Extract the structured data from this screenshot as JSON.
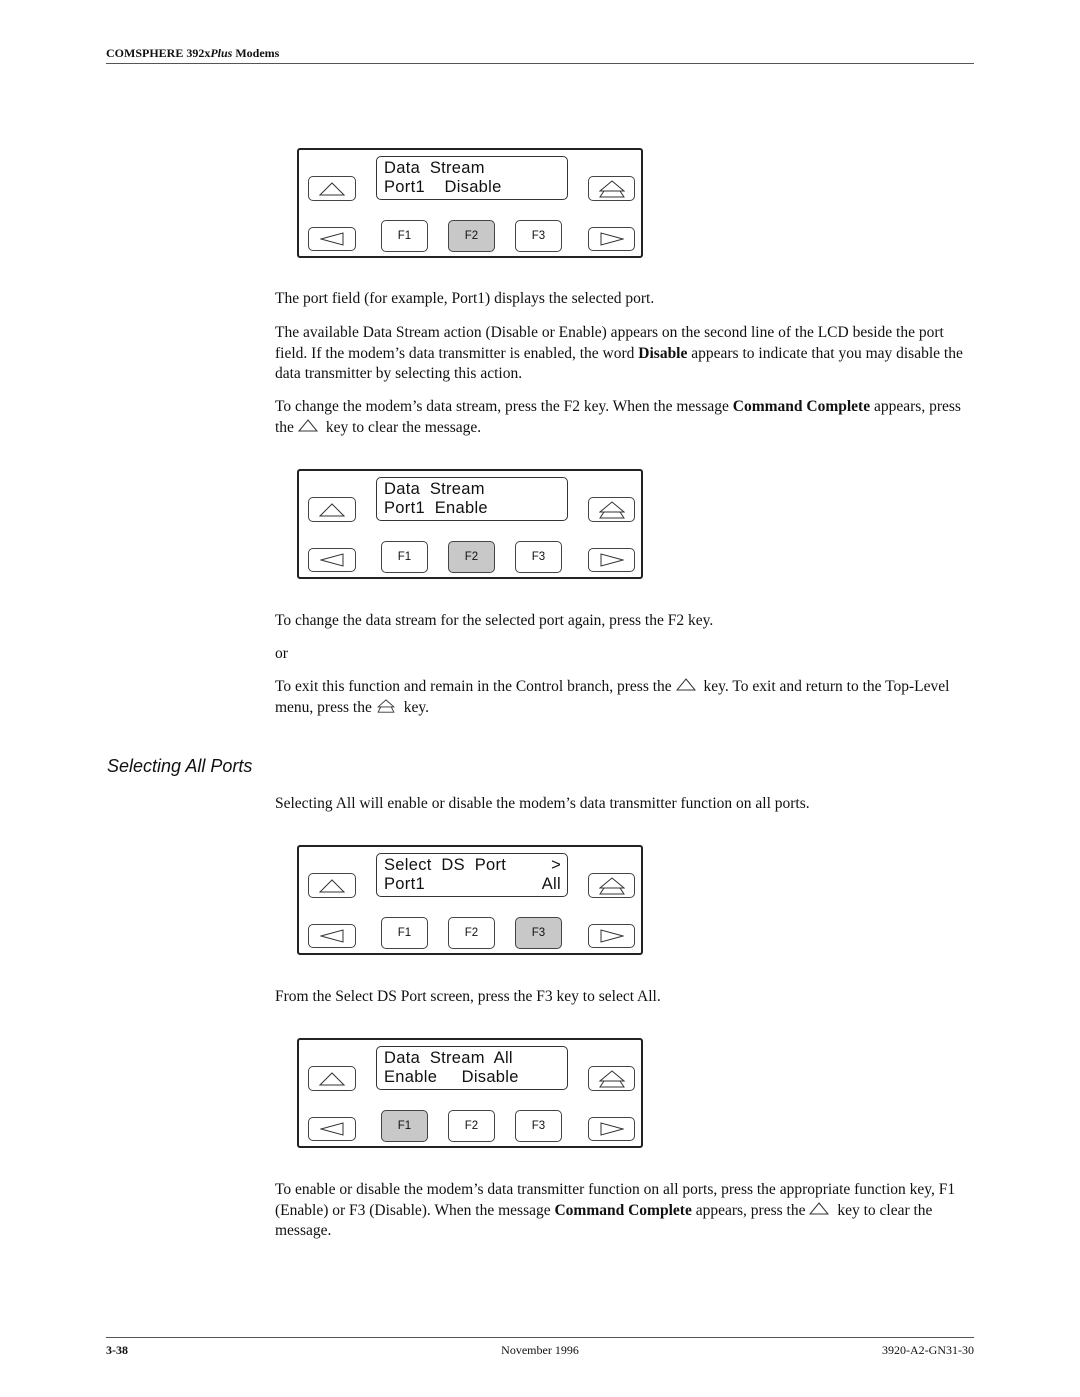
{
  "header": {
    "prefix": "COMSPHERE 392x",
    "italic": "Plus",
    "suffix": " Modems"
  },
  "panels": [
    {
      "lcd_line1_left": "Data  Stream",
      "lcd_line1_right": "",
      "lcd_line2_left": "Port1    Disable",
      "lcd_line2_right": "",
      "active_key": "F2"
    },
    {
      "lcd_line1_left": "Data  Stream",
      "lcd_line1_right": "",
      "lcd_line2_left": "Port1  Enable",
      "lcd_line2_right": "",
      "active_key": "F2"
    },
    {
      "lcd_line1_left": "Select  DS  Port",
      "lcd_line1_right": ">",
      "lcd_line2_left": "Port1",
      "lcd_line2_right": "All",
      "active_key": "F3"
    },
    {
      "lcd_line1_left": "Data  Stream  All",
      "lcd_line1_right": "",
      "lcd_line2_left": "Enable     Disable",
      "lcd_line2_right": "",
      "active_key": "F1"
    }
  ],
  "function_keys": {
    "f1": "F1",
    "f2": "F2",
    "f3": "F3"
  },
  "icons": {
    "up_key": "up-arrow-key-icon",
    "top_key": "top-level-double-arrow-key-icon",
    "left_key": "left-arrow-key-icon",
    "right_key": "right-arrow-key-icon"
  },
  "text": {
    "p1": "The port field (for example, Port1) displays the selected port.",
    "p2_a": "The available Data Stream action (Disable or Enable) appears on the second line of the LCD beside the port field. If the modem’s data transmitter is enabled, the word ",
    "p2_bold": "Disable",
    "p2_b": " appears to indicate that you may disable the data transmitter by selecting this action.",
    "p3_a": "To change the modem’s data stream, press the F2 key. When the message ",
    "p3_bold": "Command Complete",
    "p3_b": " appears, press the",
    "p3_c": " key to clear the message.",
    "p4": "To change the data stream for the selected port again, press the F2 key.",
    "p5": "or",
    "p6_a": "To exit this function and remain in the Control branch, press the",
    "p6_b": " key. To exit and return to the Top-Level menu, press the",
    "p6_c": " key.",
    "section_title": "Selecting All Ports",
    "p7": "Selecting All will enable or disable the modem’s data transmitter function on all ports.",
    "p8": "From the Select DS Port screen, press the F3 key to select All.",
    "p9_a": "To enable or disable the modem’s data transmitter function on all ports, press the appropriate function key, F1 (Enable) or F3 (Disable). When the message ",
    "p9_bold": "Command Complete",
    "p9_b": " appears, press the",
    "p9_c": " key to clear the message."
  },
  "footer": {
    "page": "3-38",
    "date": "November 1996",
    "doc_id": "3920-A2-GN31-30"
  }
}
